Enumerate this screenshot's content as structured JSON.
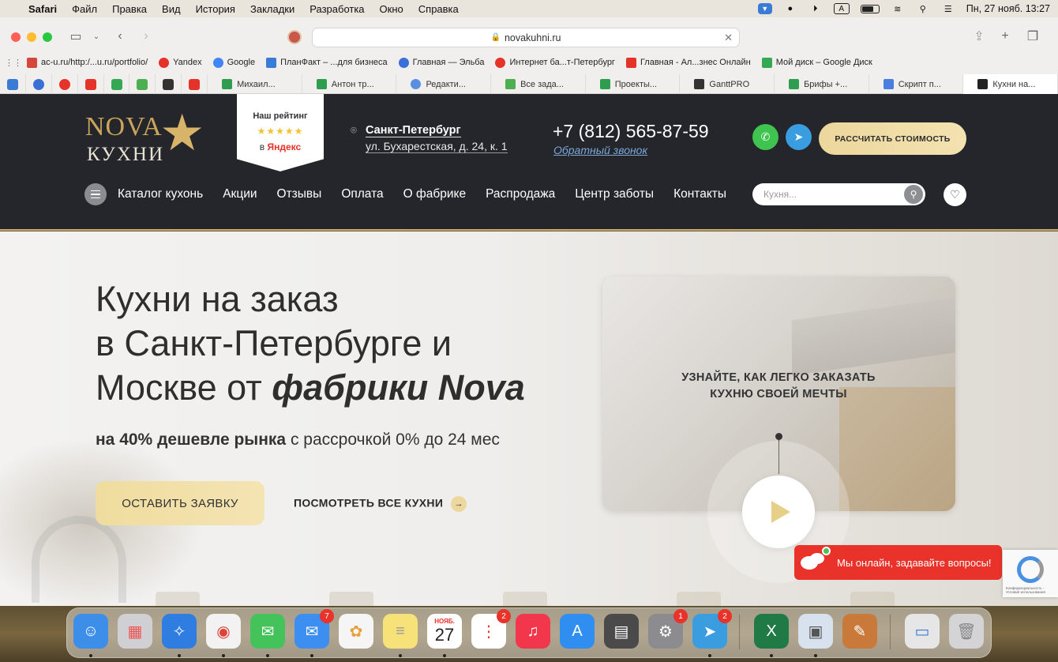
{
  "menubar": {
    "app": "Safari",
    "items": [
      "Файл",
      "Правка",
      "Вид",
      "История",
      "Закладки",
      "Разработка",
      "Окно",
      "Справка"
    ],
    "datetime": "Пн, 27 нояб.  13:27",
    "input_source": "A"
  },
  "browser": {
    "url": "novakuhni.ru",
    "bookmarks": [
      {
        "label": "ac-u.ru/http:/...u.ru/portfolio/",
        "color": "#d4473a",
        "icon": "ac-u-icon"
      },
      {
        "label": "Yandex",
        "color": "#e5332a",
        "icon": "yandex-icon"
      },
      {
        "label": "Google",
        "color": "#4285f4",
        "icon": "google-icon"
      },
      {
        "label": "ПланФакт – ...для бизнеса",
        "color": "#3a7bd5",
        "icon": "planfact-icon"
      },
      {
        "label": "Главная — Эльба",
        "color": "#3b6fd8",
        "icon": "elba-icon"
      },
      {
        "label": "Интернет ба...т-Петербург",
        "color": "#e5332a",
        "icon": "bank-icon"
      },
      {
        "label": "Главная - Ал...знес Онлайн",
        "color": "#e5332a",
        "icon": "alfa-icon"
      },
      {
        "label": "Мой диск – Google Диск",
        "color": "#34a853",
        "icon": "gdrive-icon"
      }
    ],
    "tab_icons": [
      "#3a7bd5",
      "#3b6fd8",
      "#e5332a",
      "#e5332a",
      "#34a853",
      "#4caf50",
      "#333333",
      "#e5332a"
    ],
    "tabs": [
      {
        "label": "Михаил...",
        "color": "#2e9d4f"
      },
      {
        "label": "Антон тр...",
        "color": "#2e9d4f"
      },
      {
        "label": "Редакти...",
        "color": "#5a8fe0"
      },
      {
        "label": "Все зада...",
        "color": "#4caf50"
      },
      {
        "label": "Проекты...",
        "color": "#2e9d4f"
      },
      {
        "label": "GanttPRO",
        "color": "#333333"
      },
      {
        "label": "Брифы +...",
        "color": "#2e9d4f"
      },
      {
        "label": "Скрипт п...",
        "color": "#4a7fe0"
      },
      {
        "label": "Кухни на...",
        "color": "#222222",
        "active": true
      }
    ]
  },
  "header": {
    "logo_top": "NOVA",
    "logo_bottom": "КУХНИ",
    "rating_title": "Наш рейтинг",
    "rating_stars": "★★★★★",
    "rating_source_prefix": "в ",
    "rating_source": "Яндекс",
    "city": "Санкт-Петербург",
    "address": "ул. Бухарестская, д. 24, к. 1",
    "phone": "+7 (812) 565-87-59",
    "callback": "Обратный звонок",
    "cta": "РАССЧИТАТЬ СТОИМОСТЬ",
    "whatsapp_color": "#3fc44f",
    "telegram_color": "#3a9de0",
    "nav": [
      "Каталог кухонь",
      "Акции",
      "Отзывы",
      "Оплата",
      "О фабрике",
      "Распродажа",
      "Центр заботы",
      "Контакты"
    ],
    "search_placeholder": "Кухня..."
  },
  "hero": {
    "title_line1": "Кухни на заказ",
    "title_line2": "в Санкт-Петербурге и",
    "title_line3_plain": "Москве от ",
    "title_line3_em": "фабрики Nova",
    "sub_bold": "на 40% дешевле рынка",
    "sub_rest": " с рассрочкой 0% до 24 мес",
    "cta": "ОСТАВИТЬ ЗАЯВКУ",
    "see_all": "ПОСМОТРЕТЬ ВСЕ КУХНИ",
    "video_text": "УЗНАЙТЕ, КАК ЛЕГКО ЗАКАЗАТЬ КУХНЮ СВОЕЙ МЕЧТЫ"
  },
  "chat": {
    "text": "Мы онлайн, задавайте вопросы!",
    "recaptcha_text": "Конфиденциальность - Условия использования"
  },
  "dock": {
    "apps": [
      {
        "name": "finder",
        "color": "#3d8ee8"
      },
      {
        "name": "launchpad",
        "color": "#cfcfd4"
      },
      {
        "name": "safari",
        "color": "#2f7de0"
      },
      {
        "name": "chrome",
        "color": "#f2f2f2"
      },
      {
        "name": "messages",
        "color": "#45c35b"
      },
      {
        "name": "mail",
        "color": "#3c8ef0",
        "badge": "7"
      },
      {
        "name": "photos",
        "color": "#f5f5f5"
      },
      {
        "name": "notes",
        "color": "#f7e27a"
      },
      {
        "name": "calendar",
        "color": "#ffffff",
        "month": "НОЯБ.",
        "day": "27"
      },
      {
        "name": "reminders",
        "color": "#ffffff",
        "badge": "2"
      },
      {
        "name": "music",
        "color": "#f2374c"
      },
      {
        "name": "app-store",
        "color": "#2f8ef0"
      },
      {
        "name": "calculator",
        "color": "#4a4a4a"
      },
      {
        "name": "system-settings",
        "color": "#8c8c90",
        "badge": "1"
      },
      {
        "name": "telegram",
        "color": "#3a9de0",
        "badge": "2"
      },
      {
        "name": "excel",
        "color": "#1f7a45"
      },
      {
        "name": "preview",
        "color": "#d8e2ef"
      },
      {
        "name": "script-editor",
        "color": "#c97a3a"
      },
      {
        "name": "window-preview",
        "color": "#e6e6e6"
      },
      {
        "name": "trash",
        "color": "#d4d4d6"
      }
    ]
  }
}
